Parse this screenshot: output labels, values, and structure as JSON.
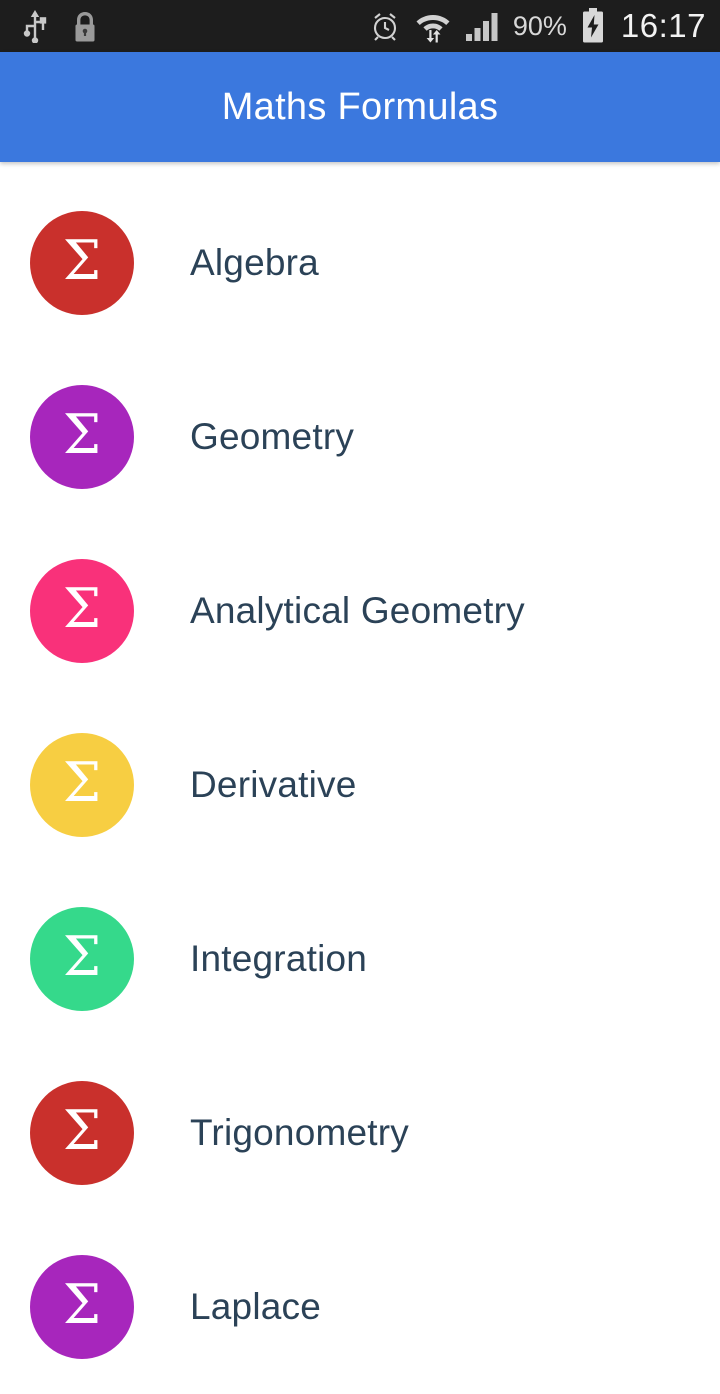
{
  "status_bar": {
    "left_icons": [
      "usb-icon",
      "lock-icon"
    ],
    "right_icons": [
      "alarm-icon",
      "wifi-transfer-icon",
      "signal-bars-icon",
      "battery-charging-icon"
    ],
    "battery_percent": "90%",
    "time": "16:17",
    "background_color": "#1d1d1d"
  },
  "app_bar": {
    "title": "Maths Formulas",
    "background_color": "#3b78de",
    "title_color": "#ffffff"
  },
  "list": {
    "icon_glyph": "Σ",
    "label_color": "#2b4257",
    "items": [
      {
        "label": "Algebra",
        "color": "#c9302c",
        "icon": "sigma-icon"
      },
      {
        "label": "Geometry",
        "color": "#a726bc",
        "icon": "sigma-icon"
      },
      {
        "label": "Analytical Geometry",
        "color": "#f9317a",
        "icon": "sigma-icon"
      },
      {
        "label": "Derivative",
        "color": "#f7ce42",
        "icon": "sigma-icon"
      },
      {
        "label": "Integration",
        "color": "#35d98b",
        "icon": "sigma-icon"
      },
      {
        "label": "Trigonometry",
        "color": "#c9302c",
        "icon": "sigma-icon"
      },
      {
        "label": "Laplace",
        "color": "#a726bc",
        "icon": "sigma-icon"
      }
    ]
  }
}
